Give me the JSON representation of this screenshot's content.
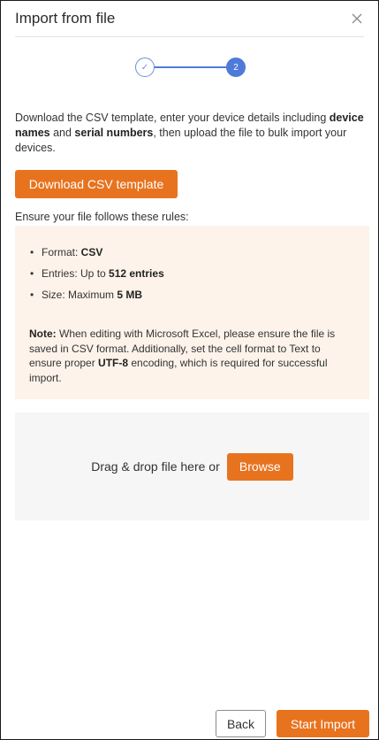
{
  "dialog": {
    "title": "Import from file",
    "close_icon": "close-icon"
  },
  "stepper": {
    "step1_icon": "check-icon",
    "step1_glyph": "✓",
    "step2_label": "2",
    "current_step": 2,
    "accent_color": "#4f7ad8"
  },
  "intro": {
    "part1": "Download the CSV template, enter your device details including ",
    "bold1": "device names",
    "part2": " and ",
    "bold2": "serial numbers",
    "part3": ", then upload the file to bulk import your devices."
  },
  "download_button": {
    "label": "Download CSV template"
  },
  "rules": {
    "heading": "Ensure your file follows these rules:",
    "items": [
      {
        "prefix": "Format: ",
        "value": "CSV"
      },
      {
        "prefix": "Entries: Up to ",
        "value": "512 entries"
      },
      {
        "prefix": "Size: Maximum ",
        "value": "5 MB"
      }
    ],
    "note": {
      "label": "Note:",
      "part1": " When editing with Microsoft Excel, please ensure the file is saved in CSV format. Additionally, set the cell format to Text to ensure proper ",
      "bold": "UTF-8",
      "part2": " encoding, which is required for successful import."
    }
  },
  "dropzone": {
    "text": "Drag & drop file here or",
    "browse_label": "Browse"
  },
  "footer": {
    "back_label": "Back",
    "start_label": "Start Import"
  },
  "colors": {
    "brand_orange": "#e8731f",
    "rules_background": "#fdf3ea",
    "dropzone_background": "#f6f6f6"
  }
}
